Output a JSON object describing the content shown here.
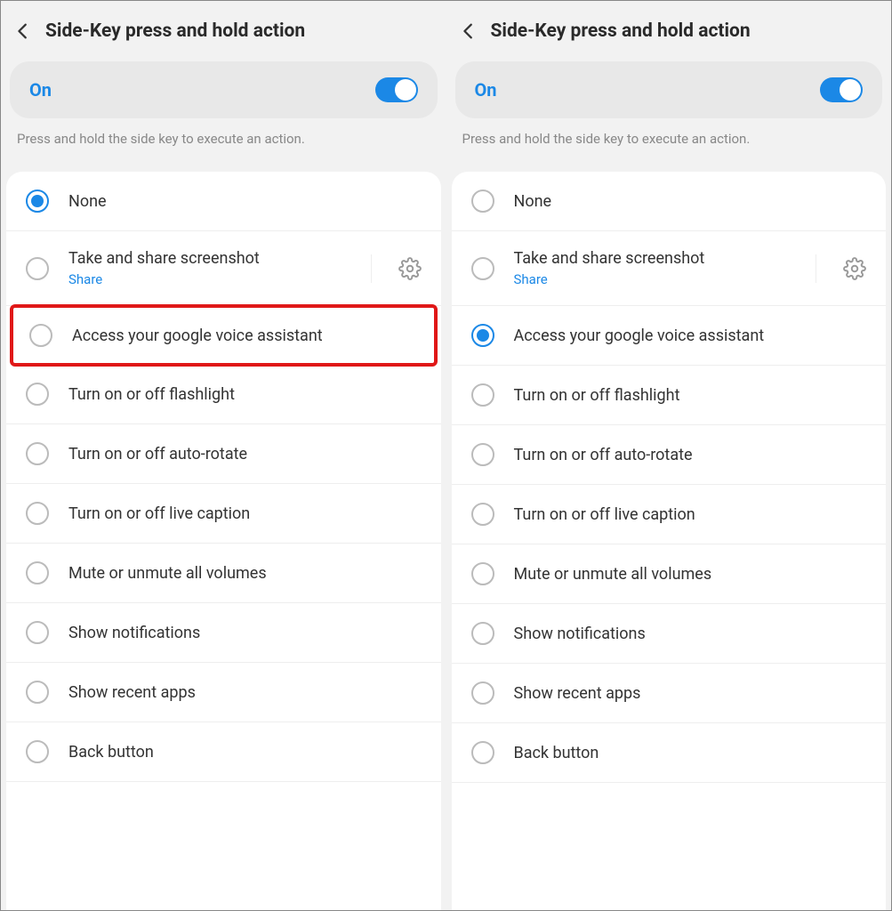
{
  "left": {
    "title": "Side-Key press and hold action",
    "toggle": {
      "label": "On",
      "state": true
    },
    "description": "Press and hold the side key to execute an action.",
    "selectedIndex": 0,
    "highlightedIndex": 2,
    "items": [
      {
        "label": "None"
      },
      {
        "label": "Take and share screenshot",
        "sub": "Share",
        "gear": true
      },
      {
        "label": "Access your google voice assistant"
      },
      {
        "label": "Turn on or off flashlight"
      },
      {
        "label": "Turn on or off auto-rotate"
      },
      {
        "label": "Turn on or off live caption"
      },
      {
        "label": "Mute or unmute all volumes"
      },
      {
        "label": "Show notifications"
      },
      {
        "label": "Show recent apps"
      },
      {
        "label": "Back button"
      }
    ]
  },
  "right": {
    "title": "Side-Key press and hold action",
    "toggle": {
      "label": "On",
      "state": true
    },
    "description": "Press and hold the side key to execute an action.",
    "selectedIndex": 2,
    "highlightedIndex": -1,
    "items": [
      {
        "label": "None"
      },
      {
        "label": "Take and share screenshot",
        "sub": "Share",
        "gear": true
      },
      {
        "label": "Access your google voice assistant"
      },
      {
        "label": "Turn on or off flashlight"
      },
      {
        "label": "Turn on or off auto-rotate"
      },
      {
        "label": "Turn on or off live caption"
      },
      {
        "label": "Mute or unmute all volumes"
      },
      {
        "label": "Show notifications"
      },
      {
        "label": "Show recent apps"
      },
      {
        "label": "Back button"
      }
    ]
  }
}
